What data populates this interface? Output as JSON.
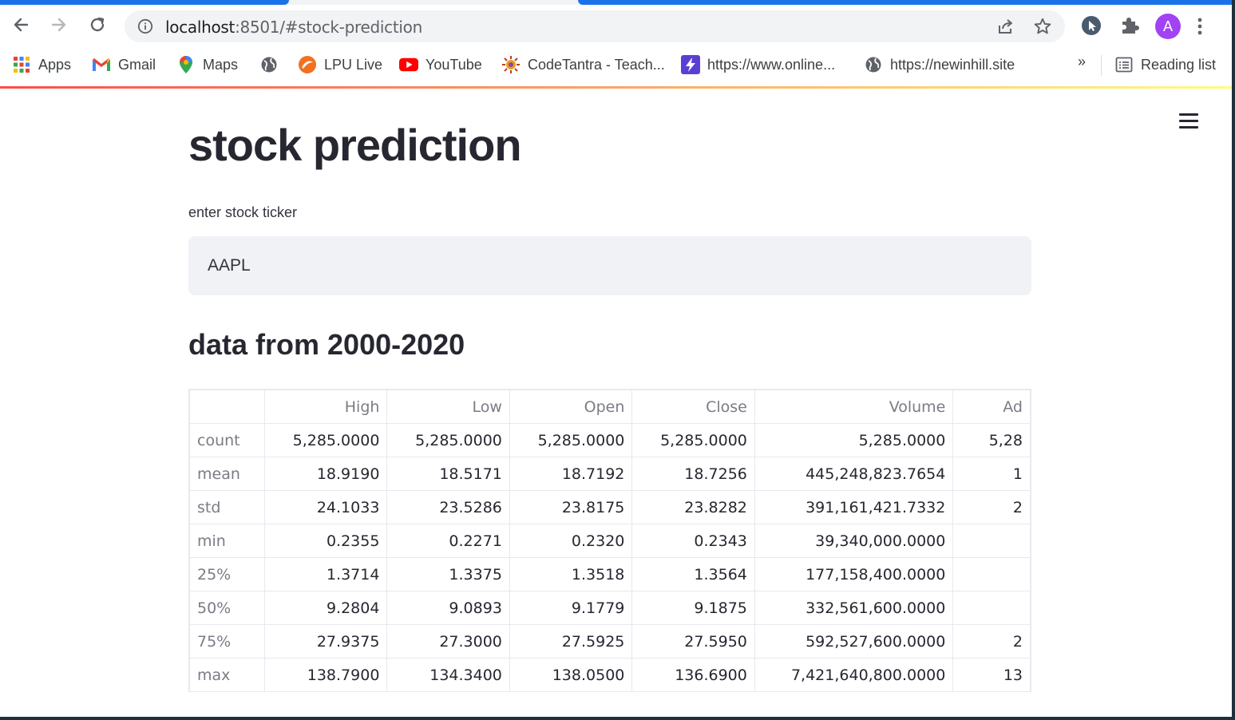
{
  "browser": {
    "url_host": "localhost",
    "url_rest": ":8501/#stock-prediction",
    "profile_initial": "A"
  },
  "bookmarks": [
    {
      "label": "Apps",
      "icon": "apps-grid-icon"
    },
    {
      "label": "Gmail",
      "icon": "gmail-icon"
    },
    {
      "label": "Maps",
      "icon": "maps-pin-icon"
    },
    {
      "label": "",
      "icon": "globe-icon"
    },
    {
      "label": "LPU Live",
      "icon": "lpu-live-icon"
    },
    {
      "label": "YouTube",
      "icon": "youtube-icon"
    },
    {
      "label": "CodeTantra - Teach...",
      "icon": "codetantra-icon"
    },
    {
      "label": "https://www.online...",
      "icon": "bolt-icon"
    },
    {
      "label": "https://newinhill.site",
      "icon": "globe-icon"
    }
  ],
  "bookmarks_overflow": "»",
  "reading_list": "Reading list",
  "app": {
    "title": "stock prediction",
    "input_label": "enter stock ticker",
    "input_value": "AAPL",
    "subheader": "data from 2000-2020"
  },
  "table": {
    "columns": [
      "",
      "High",
      "Low",
      "Open",
      "Close",
      "Volume",
      "Ad"
    ],
    "rows": [
      {
        "index": "count",
        "values": [
          "5,285.0000",
          "5,285.0000",
          "5,285.0000",
          "5,285.0000",
          "5,285.0000",
          "5,28"
        ]
      },
      {
        "index": "mean",
        "values": [
          "18.9190",
          "18.5171",
          "18.7192",
          "18.7256",
          "445,248,823.7654",
          "1"
        ]
      },
      {
        "index": "std",
        "values": [
          "24.1033",
          "23.5286",
          "23.8175",
          "23.8282",
          "391,161,421.7332",
          "2"
        ]
      },
      {
        "index": "min",
        "values": [
          "0.2355",
          "0.2271",
          "0.2320",
          "0.2343",
          "39,340,000.0000",
          ""
        ]
      },
      {
        "index": "25%",
        "values": [
          "1.3714",
          "1.3375",
          "1.3518",
          "1.3564",
          "177,158,400.0000",
          ""
        ]
      },
      {
        "index": "50%",
        "values": [
          "9.2804",
          "9.0893",
          "9.1779",
          "9.1875",
          "332,561,600.0000",
          ""
        ]
      },
      {
        "index": "75%",
        "values": [
          "27.9375",
          "27.3000",
          "27.5925",
          "27.5950",
          "592,527,600.0000",
          "2"
        ]
      },
      {
        "index": "max",
        "values": [
          "138.7900",
          "134.3400",
          "138.0500",
          "136.6900",
          "7,421,640,800.0000",
          "13"
        ]
      }
    ]
  }
}
